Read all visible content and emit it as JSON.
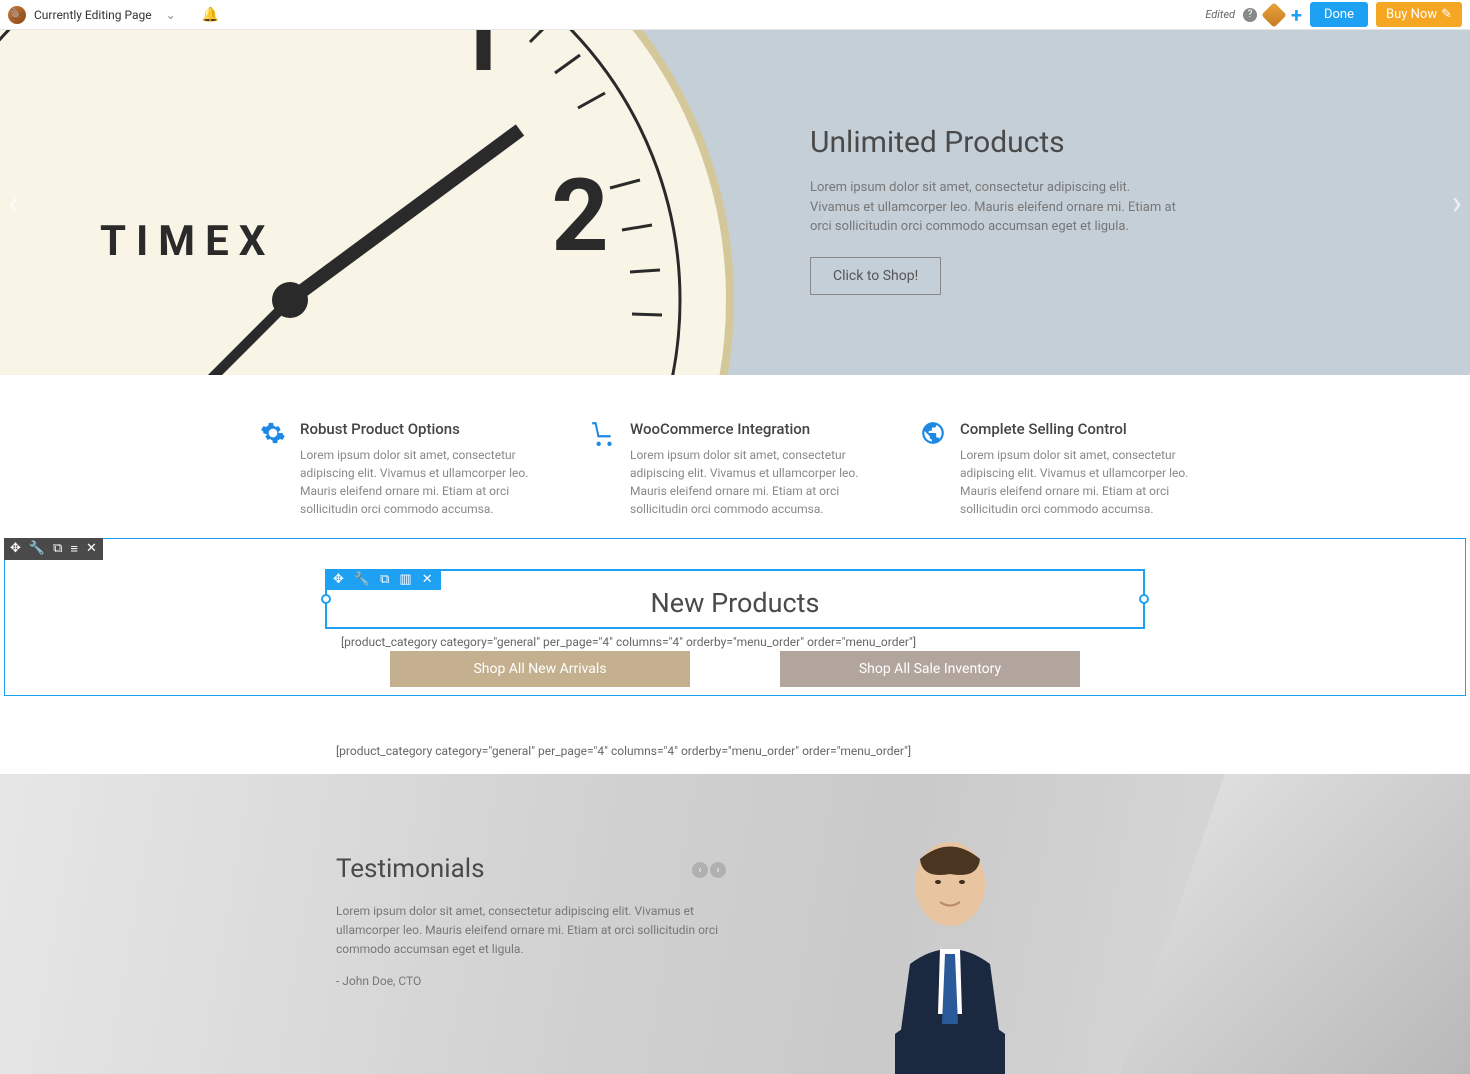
{
  "topbar": {
    "title": "Currently Editing Page",
    "edited": "Edited",
    "done": "Done",
    "buy_now": "Buy Now"
  },
  "hero": {
    "brand": "TIMEX",
    "title": "Unlimited Products",
    "text": "Lorem ipsum dolor sit amet, consectetur adipiscing elit. Vivamus et ullamcorper leo. Mauris eleifend ornare mi. Etiam at orci sollicitudin orci commodo accumsan eget et ligula.",
    "button": "Click to Shop!"
  },
  "features": [
    {
      "title": "Robust Product Options",
      "text": "Lorem ipsum dolor sit amet, consectetur adipiscing elit. Vivamus et ullamcorper leo. Mauris eleifend ornare mi. Etiam at orci sollicitudin orci commodo accumsa."
    },
    {
      "title": "WooCommerce Integration",
      "text": "Lorem ipsum dolor sit amet, consectetur adipiscing elit. Vivamus et ullamcorper leo. Mauris eleifend ornare mi. Etiam at orci sollicitudin orci commodo accumsa."
    },
    {
      "title": "Complete Selling Control",
      "text": "Lorem ipsum dolor sit amet, consectetur adipiscing elit. Vivamus et ullamcorper leo. Mauris eleifend ornare mi. Etiam at orci sollicitudin orci commodo accumsa."
    }
  ],
  "products": {
    "heading": "New Products",
    "shortcode": "[product_category category=\"general\" per_page=\"4\" columns=\"4\" orderby=\"menu_order\" order=\"menu_order\"]",
    "btn1": "Shop All New Arrivals",
    "btn2": "Shop All Sale Inventory"
  },
  "testimonials": {
    "title": "Testimonials",
    "text": "Lorem ipsum dolor sit amet, consectetur adipiscing elit. Vivamus et ullamcorper leo. Mauris eleifend ornare mi. Etiam at orci sollicitudin orci commodo accumsan eget et ligula.",
    "author": "- John Doe, CTO"
  }
}
